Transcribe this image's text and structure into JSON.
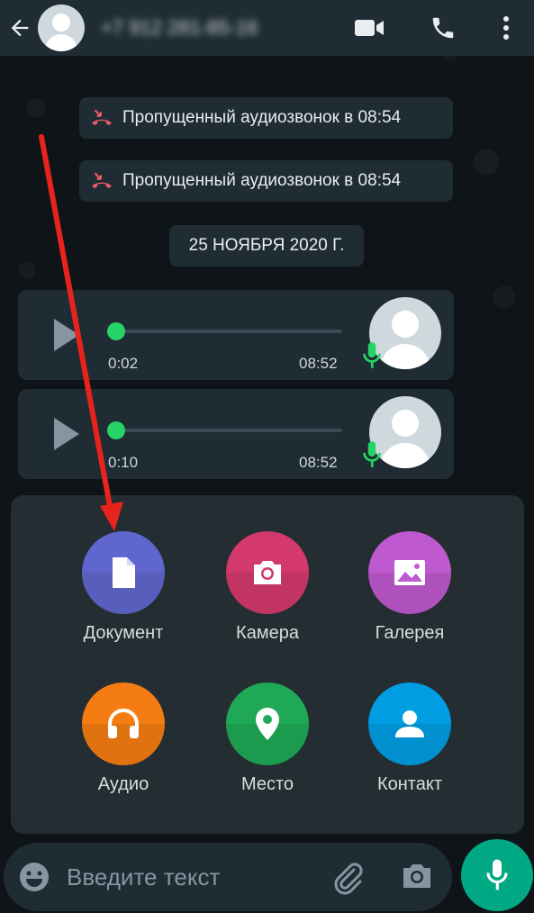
{
  "header": {
    "contact_name": "+7 912 281-85-16",
    "back_icon": "arrow-left-icon",
    "video_icon": "video-call-icon",
    "call_icon": "phone-icon",
    "menu_icon": "more-vert-icon"
  },
  "messages": {
    "missed_calls": [
      {
        "text": "Пропущенный аудиозвонок в 08:54",
        "icon": "missed-call-icon"
      },
      {
        "text": "Пропущенный аудиозвонок в 08:54",
        "icon": "missed-call-icon"
      }
    ],
    "date_divider": "25 НОЯБРЯ 2020 Г.",
    "voice_notes": [
      {
        "duration": "0:02",
        "time": "08:52",
        "progress": 0
      },
      {
        "duration": "0:10",
        "time": "08:52",
        "progress": 0
      }
    ]
  },
  "attach_menu": {
    "items": [
      {
        "label": "Документ",
        "icon": "document-icon",
        "color": "#5f66cd"
      },
      {
        "label": "Камера",
        "icon": "camera-icon",
        "color": "#d3396d"
      },
      {
        "label": "Галерея",
        "icon": "gallery-icon",
        "color": "#bf59cf"
      },
      {
        "label": "Аудио",
        "icon": "headphones-icon",
        "color": "#f57c12"
      },
      {
        "label": "Место",
        "icon": "location-icon",
        "color": "#1fa855"
      },
      {
        "label": "Контакт",
        "icon": "contact-icon",
        "color": "#009de2"
      }
    ]
  },
  "input": {
    "placeholder": "Введите текст",
    "emoji_icon": "emoji-icon",
    "attach_icon": "paperclip-icon",
    "camera_icon": "camera-icon",
    "mic_icon": "mic-icon"
  },
  "colors": {
    "accent": "#00a884",
    "voice_dot": "#25d366",
    "annotation_arrow": "#e8231c"
  }
}
